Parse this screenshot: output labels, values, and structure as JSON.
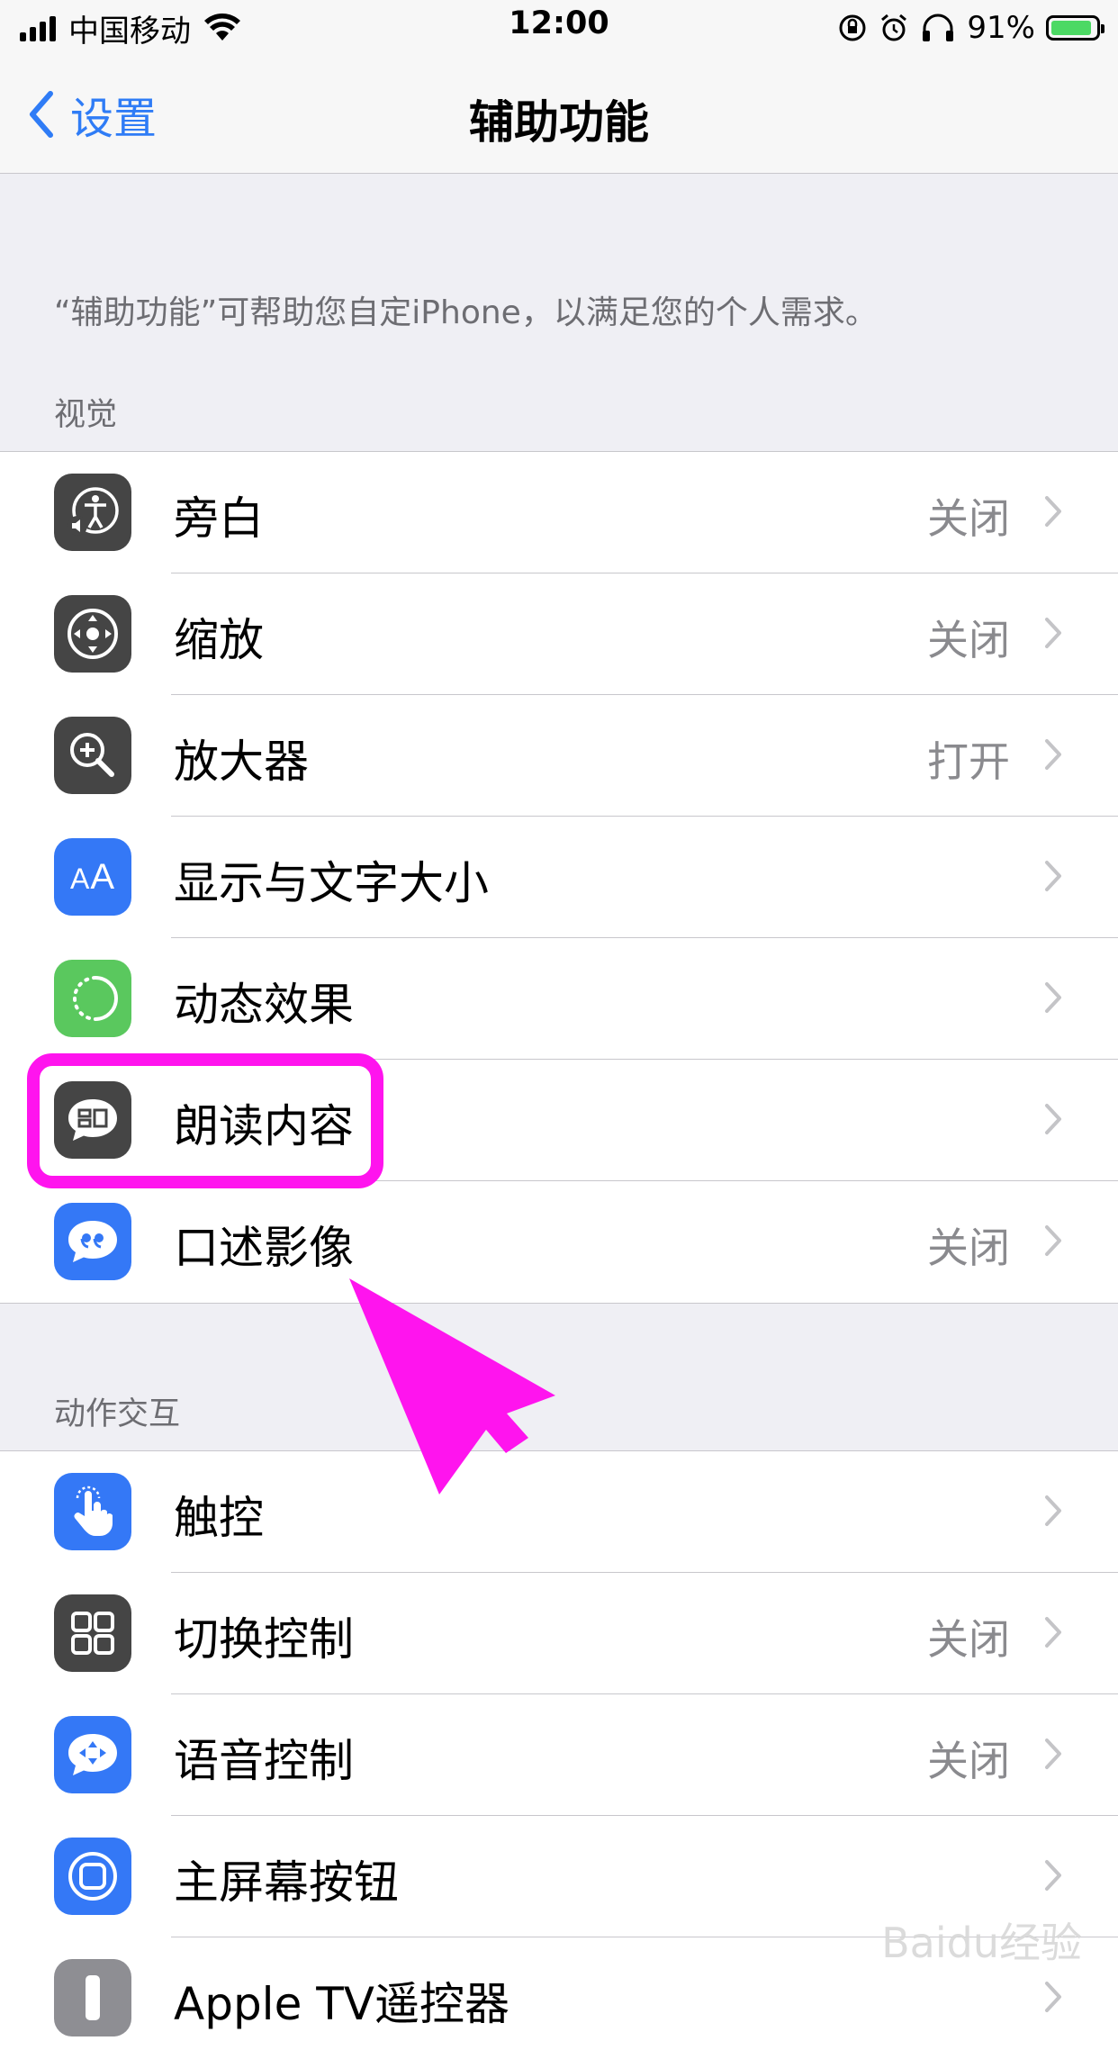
{
  "status_bar": {
    "carrier": "中国移动",
    "time": "12:00",
    "battery_percent": "91%",
    "battery_level": 0.91
  },
  "nav": {
    "back_label": "设置",
    "title": "辅助功能"
  },
  "description": "“辅助功能”可帮助您自定iPhone，以满足您的个人需求。",
  "sections": {
    "vision": {
      "header": "视觉",
      "items": [
        {
          "label": "旁白",
          "value": "关闭",
          "icon": "voiceover-icon"
        },
        {
          "label": "缩放",
          "value": "关闭",
          "icon": "zoom-icon"
        },
        {
          "label": "放大器",
          "value": "打开",
          "icon": "magnifier-icon"
        },
        {
          "label": "显示与文字大小",
          "value": "",
          "icon": "text-size-icon"
        },
        {
          "label": "动态效果",
          "value": "",
          "icon": "motion-icon"
        },
        {
          "label": "朗读内容",
          "value": "",
          "icon": "spoken-content-icon"
        },
        {
          "label": "口述影像",
          "value": "关闭",
          "icon": "audio-description-icon"
        }
      ]
    },
    "interaction": {
      "header": "动作交互",
      "items": [
        {
          "label": "触控",
          "value": "",
          "icon": "touch-icon"
        },
        {
          "label": "切换控制",
          "value": "关闭",
          "icon": "switch-control-icon"
        },
        {
          "label": "语音控制",
          "value": "关闭",
          "icon": "voice-control-icon"
        },
        {
          "label": "主屏幕按钮",
          "value": "",
          "icon": "home-button-icon"
        },
        {
          "label": "Apple TV遥控器",
          "value": "",
          "icon": "tv-remote-icon"
        }
      ]
    }
  },
  "watermark": "Baidu经验",
  "colors": {
    "accent": "#2f7cf6",
    "highlight": "#ff14ee",
    "background": "#efeff4"
  }
}
